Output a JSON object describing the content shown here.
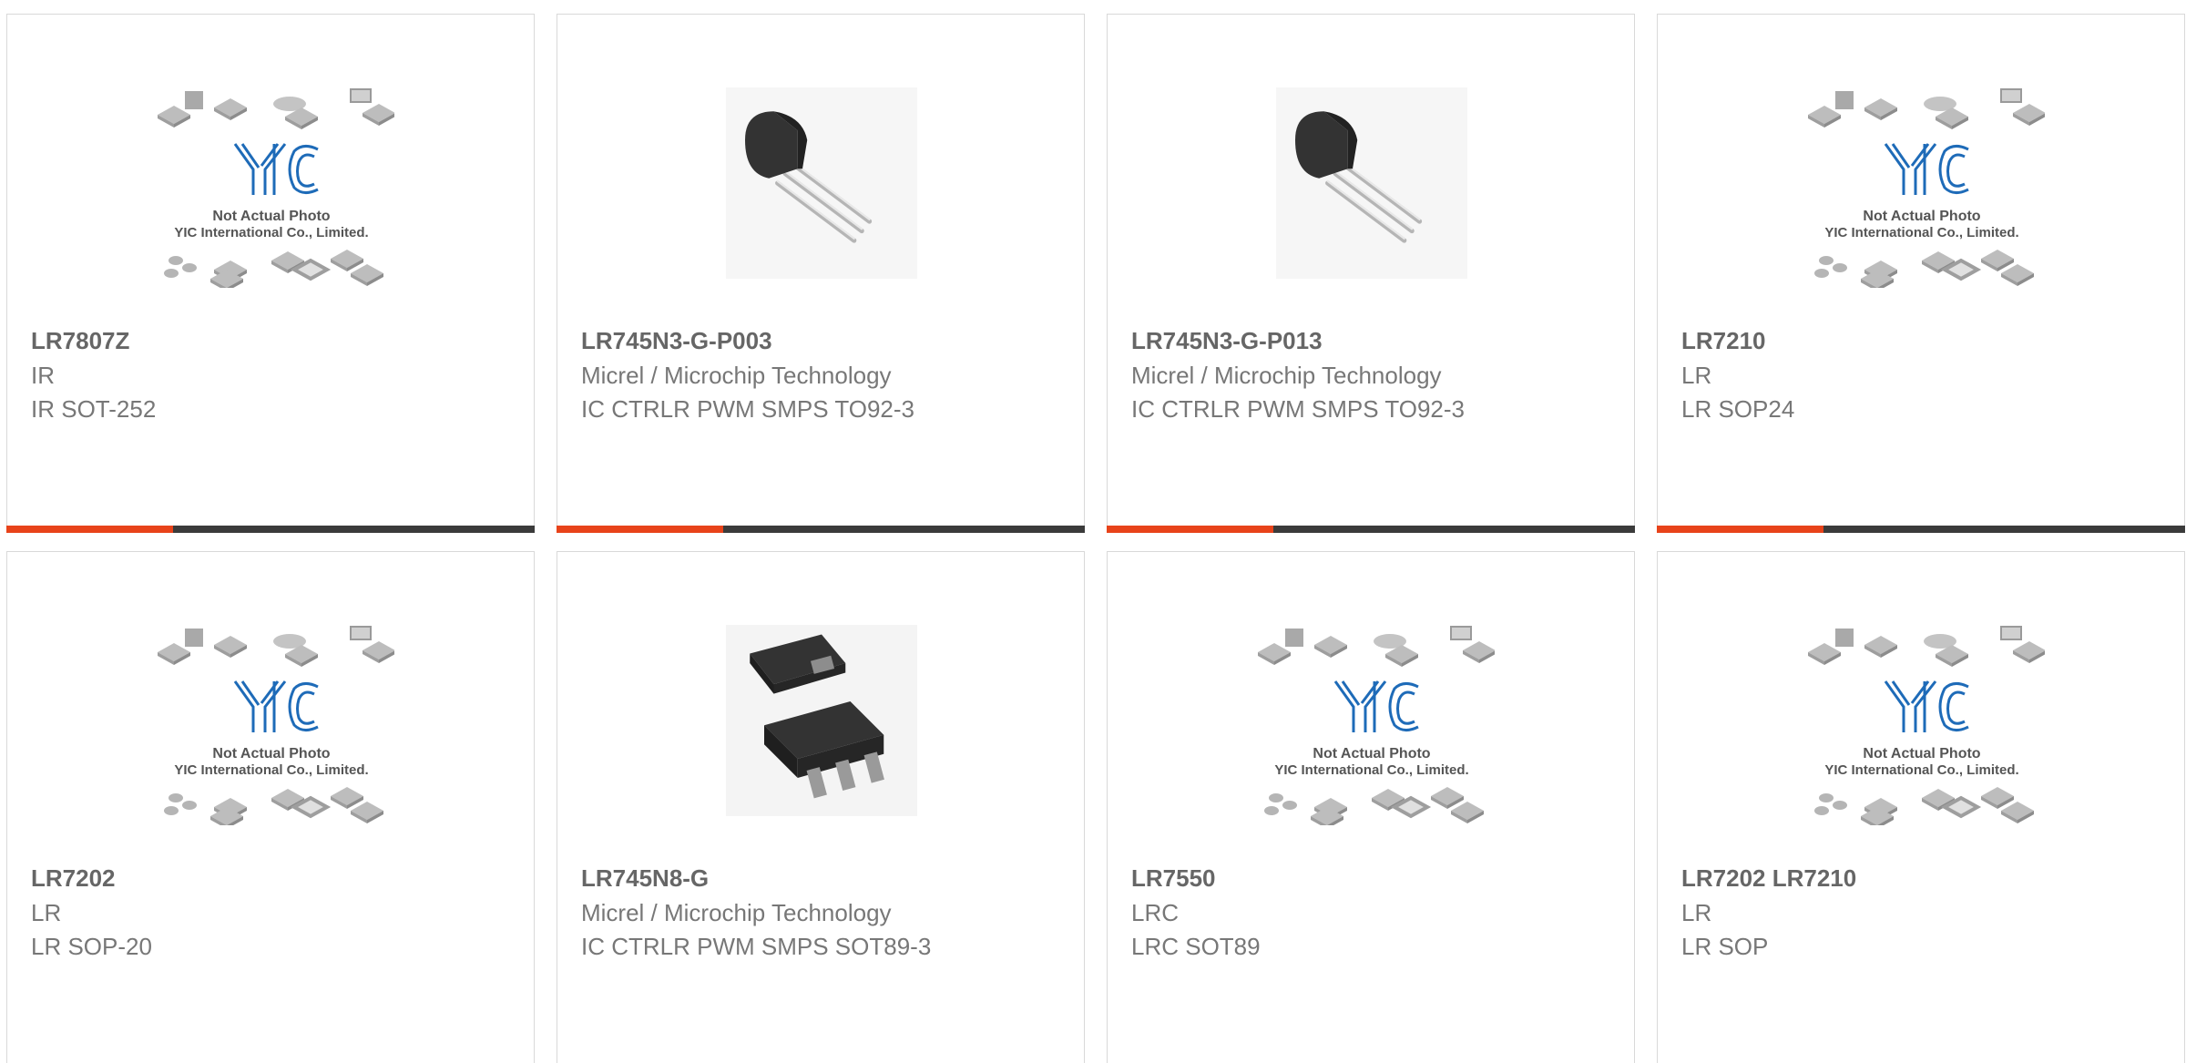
{
  "colors": {
    "accent": "#e8431a",
    "bar": "#3b3b3b",
    "logo_blue": "#1e6bb8"
  },
  "placeholder_image": {
    "line1": "Not Actual Photo",
    "line2": "YIC International Co., Limited."
  },
  "products": [
    {
      "part": "LR7807Z",
      "manufacturer": "IR",
      "description": "IR SOT-252",
      "image": "placeholder-yic-icon"
    },
    {
      "part": "LR745N3-G-P003",
      "manufacturer": "Micrel / Microchip Technology",
      "description": "IC CTRLR PWM SMPS TO92-3",
      "image": "to92-transistor-icon"
    },
    {
      "part": "LR745N3-G-P013",
      "manufacturer": "Micrel / Microchip Technology",
      "description": "IC CTRLR PWM SMPS TO92-3",
      "image": "to92-transistor-icon"
    },
    {
      "part": "LR7210",
      "manufacturer": "LR",
      "description": "LR SOP24",
      "image": "placeholder-yic-icon"
    },
    {
      "part": "LR7202",
      "manufacturer": "LR",
      "description": "LR SOP-20",
      "image": "placeholder-yic-icon"
    },
    {
      "part": "LR745N8-G",
      "manufacturer": "Micrel / Microchip Technology",
      "description": "IC CTRLR PWM SMPS SOT89-3",
      "image": "sot89-package-icon"
    },
    {
      "part": "LR7550",
      "manufacturer": "LRC",
      "description": "LRC SOT89",
      "image": "placeholder-yic-icon"
    },
    {
      "part": "LR7202 LR7210",
      "manufacturer": "LR",
      "description": "LR SOP",
      "image": "placeholder-yic-icon"
    }
  ]
}
